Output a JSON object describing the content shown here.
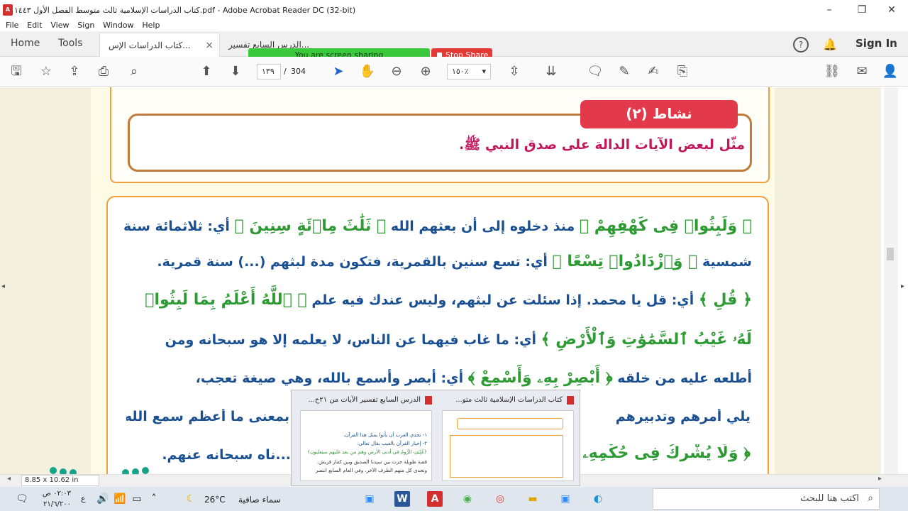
{
  "window": {
    "title": "كتاب الدراسات الإسلامية ثالث متوسط الفصل الأول ١٤٤٣.pdf - Adobe Acrobat Reader DC (32-bit)",
    "pdf_icon": "pdf-icon",
    "minimize": "–",
    "restore": "❐",
    "close": "✕"
  },
  "menu": [
    "File",
    "Edit",
    "View",
    "Sign",
    "Window",
    "Help"
  ],
  "tabs": {
    "home": "Home",
    "tools": "Tools",
    "doc1": "كتاب الدراسات الإس...",
    "doc2": "الدرس السابع تفسير...",
    "close": "×",
    "sign_in": "Sign In"
  },
  "share": {
    "label": "You are screen sharing",
    "stop": "Stop Share"
  },
  "toolbar": {
    "page_current": "١٣٩",
    "page_sep": "/",
    "page_total": "304",
    "zoom": "١٥٠٪"
  },
  "activity": {
    "badge": "نشاط (٢)",
    "text": "مثّل لبعض الآيات الدالة على صدق النبي ﷺ."
  },
  "content": {
    "l1": [
      "﴿ وَلَبِثُوا۟ فِى كَهْفِهِمْ ﴾",
      " منذ دخلوه إلى أن بعثهم الله ",
      "﴿ ثَلَٰثَ مِا۟ئَةٍ سِنِينَ ﴾",
      " أي: ثلاثمائة سنة"
    ],
    "l2": [
      "شمسية ",
      "﴿ وَٱزْدَادُوا۟ تِسْعًا ﴾",
      " أي: تسع سنين بالقمرية، فتكون مدة لبثهم (...) سنة قمرية."
    ],
    "l3": [
      "﴿ قُلِ ﴾",
      " أي: قل يا محمد. إذا سئلت عن لبثهم، وليس عندك فيه علم ",
      "﴿ ٱللَّهُ أَعْلَمُ بِمَا لَبِثُوا۟"
    ],
    "l4": [
      "لَهُۥ غَيْبُ ٱلسَّمَٰوَٰتِ وَٱلْأَرْضِ ﴾",
      " أي: ما غاب فيهما عن الناس، لا يعلمه إلا هو سبحانه ومن"
    ],
    "l5": [
      "أطلعه عليه من خلقه ",
      "﴿ أَبْصِرْ بِهِۦ وَأَسْمِعْ ﴾",
      " أي: أبصر وأسمع بالله، وهي صيغة تعجب،"
    ],
    "l6": [
      "بمعنى ما أعظم سمع الله",
      " يلي أمرهم وتدبيرهم"
    ],
    "l7": [
      "﴿ وَلَا يُشْرِكُ فِى حُكْمِهِۦ ﴾",
      " ...ناه سبحانه عنهم."
    ]
  },
  "status": {
    "page_size": "8.85 x 10.62 in"
  },
  "thumbnails": [
    {
      "title": "كتاب الدراسات الإسلامية ثالث متو..."
    },
    {
      "title": "الدرس السابع تفسير الآيات من ٢١ح..."
    }
  ],
  "thumb2_text": [
    "١- تحدي العرب أن يأتوا بمثل هذا القرآن.",
    "٢- إخبار القرآن بالغيب بقال تعالى:",
    "﴿غُلِبَتِ الرُّومُ في أدنى الأرض وهم من بعد غلبهم سيغلبون﴾",
    "قصة طويلة جرت بين سيدنا الصديق وبين كفار قريش.",
    "وتحدى كل منهم الطرف الآخر، وفي العام السابع انتصر"
  ],
  "taskbar": {
    "search_placeholder": "اكتب هنا للبحث",
    "weather_temp": "26°C",
    "weather_text": "سماء صافية",
    "time": "٠٢:٠٣ ص",
    "date": "٢١/٦/٢٠٠",
    "lang": "ع"
  }
}
